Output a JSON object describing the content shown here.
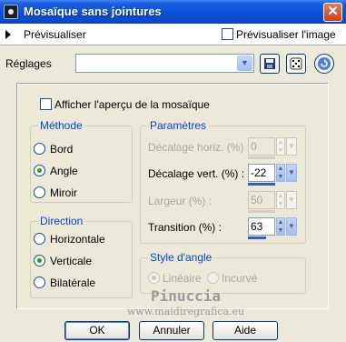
{
  "window": {
    "title": "Mosaïque sans jointures",
    "close_glyph": "✕"
  },
  "preview": {
    "expand_label": "Prévisualiser",
    "preview_image_label": "Prévisualiser l'image",
    "preview_image_checked": false
  },
  "settings": {
    "label": "Réglages",
    "selected_value": ""
  },
  "show_preview_tile": {
    "label": "Afficher l'aperçu de la mosaïque",
    "checked": false
  },
  "method": {
    "title": "Méthode",
    "options": [
      {
        "label": "Bord",
        "selected": false
      },
      {
        "label": "Angle",
        "selected": true
      },
      {
        "label": "Miroir",
        "selected": false
      }
    ]
  },
  "direction": {
    "title": "Direction",
    "options": [
      {
        "label": "Horizontale",
        "selected": false
      },
      {
        "label": "Verticale",
        "selected": true
      },
      {
        "label": "Bilatérale",
        "selected": false
      }
    ]
  },
  "parameters": {
    "title": "Paramètres",
    "fields": [
      {
        "label": "Décalage horiz. (%) :",
        "value": "0",
        "enabled": false
      },
      {
        "label": "Décalage vert. (%) :",
        "value": "-22",
        "enabled": true
      },
      {
        "label": "Largeur (%) :",
        "value": "50",
        "enabled": false
      },
      {
        "label": "Transition (%) :",
        "value": "63",
        "enabled": true
      }
    ]
  },
  "angle_style": {
    "title": "Style d'angle",
    "options": [
      {
        "label": "Linéaire",
        "selected": true,
        "enabled": false
      },
      {
        "label": "Incurvé",
        "selected": false,
        "enabled": false
      }
    ]
  },
  "watermark": {
    "name": "Pinuccia",
    "site": "www.maidiregrafica.eu"
  },
  "buttons": {
    "ok": "OK",
    "cancel": "Annuler",
    "help": "Aide"
  },
  "icons": [
    "app-icon",
    "close-icon",
    "expand-arrow-icon",
    "save-icon",
    "random-dice-icon",
    "reset-icon",
    "chevron-down-icon",
    "spin-up-icon",
    "spin-down-icon"
  ]
}
